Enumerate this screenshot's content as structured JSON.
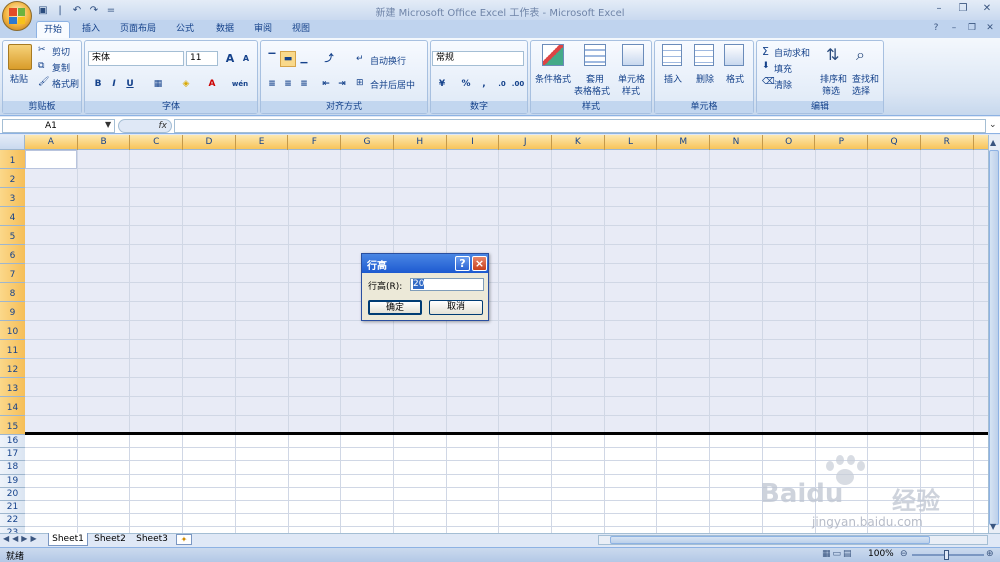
{
  "window": {
    "title": "新建 Microsoft Office Excel 工作表 - Microsoft Excel",
    "qat_separator": "|",
    "qat_more": "="
  },
  "tabs": [
    "开始",
    "插入",
    "页面布局",
    "公式",
    "数据",
    "审阅",
    "视图"
  ],
  "ribbon": {
    "clipboard": {
      "label": "剪贴板",
      "paste": "粘贴",
      "cut": "剪切",
      "copy": "复制",
      "format_painter": "格式刷"
    },
    "font": {
      "label": "字体",
      "name": "宋体",
      "size": "11",
      "bold": "B",
      "italic": "I",
      "underline": "U",
      "grow": "A",
      "shrink": "A",
      "font_color": "A",
      "phonetic": "wén"
    },
    "alignment": {
      "label": "对齐方式",
      "wrap": "自动换行",
      "merge": "合并后居中"
    },
    "number": {
      "label": "数字",
      "format": "常规",
      "percent": "%",
      "comma": ","
    },
    "styles": {
      "label": "样式",
      "conditional": "条件格式",
      "table_l1": "套用",
      "table_l2": "表格格式",
      "cell_l1": "单元格",
      "cell_l2": "样式"
    },
    "cells": {
      "label": "单元格",
      "insert": "插入",
      "delete": "删除",
      "format": "格式"
    },
    "editing": {
      "label": "编辑",
      "autosum": "自动求和",
      "fill": "填充",
      "clear": "清除",
      "sort_l1": "排序和",
      "sort_l2": "筛选",
      "find_l1": "查找和",
      "find_l2": "选择"
    }
  },
  "formula_bar": {
    "name_box": "A1",
    "fx": "fx",
    "value": ""
  },
  "columns": [
    "A",
    "B",
    "C",
    "D",
    "E",
    "F",
    "G",
    "H",
    "I",
    "J",
    "K",
    "L",
    "M",
    "N",
    "O",
    "P",
    "Q",
    "R"
  ],
  "rows_tall": [
    "1",
    "2",
    "3",
    "4",
    "5",
    "6",
    "7",
    "8",
    "9",
    "10",
    "11",
    "12",
    "13",
    "14",
    "15"
  ],
  "rows_short": [
    "16",
    "17",
    "18",
    "19",
    "20",
    "21",
    "22",
    "23"
  ],
  "sheets": [
    "Sheet1",
    "Sheet2",
    "Sheet3"
  ],
  "status": {
    "ready": "就绪",
    "zoom": "100%"
  },
  "dialog": {
    "title": "行高",
    "field_label": "行高(R):",
    "value": "20",
    "ok": "确定",
    "cancel": "取消",
    "help": "?",
    "close": "×"
  },
  "watermark": {
    "brand": "Baidu",
    "cn": "经验",
    "url": "jingyan.baidu.com"
  },
  "colors": {
    "accent": "#15428b",
    "col_header": "#f8c45a",
    "selection": "#e8ebf6",
    "dialog_title": "#1d5ad0"
  }
}
